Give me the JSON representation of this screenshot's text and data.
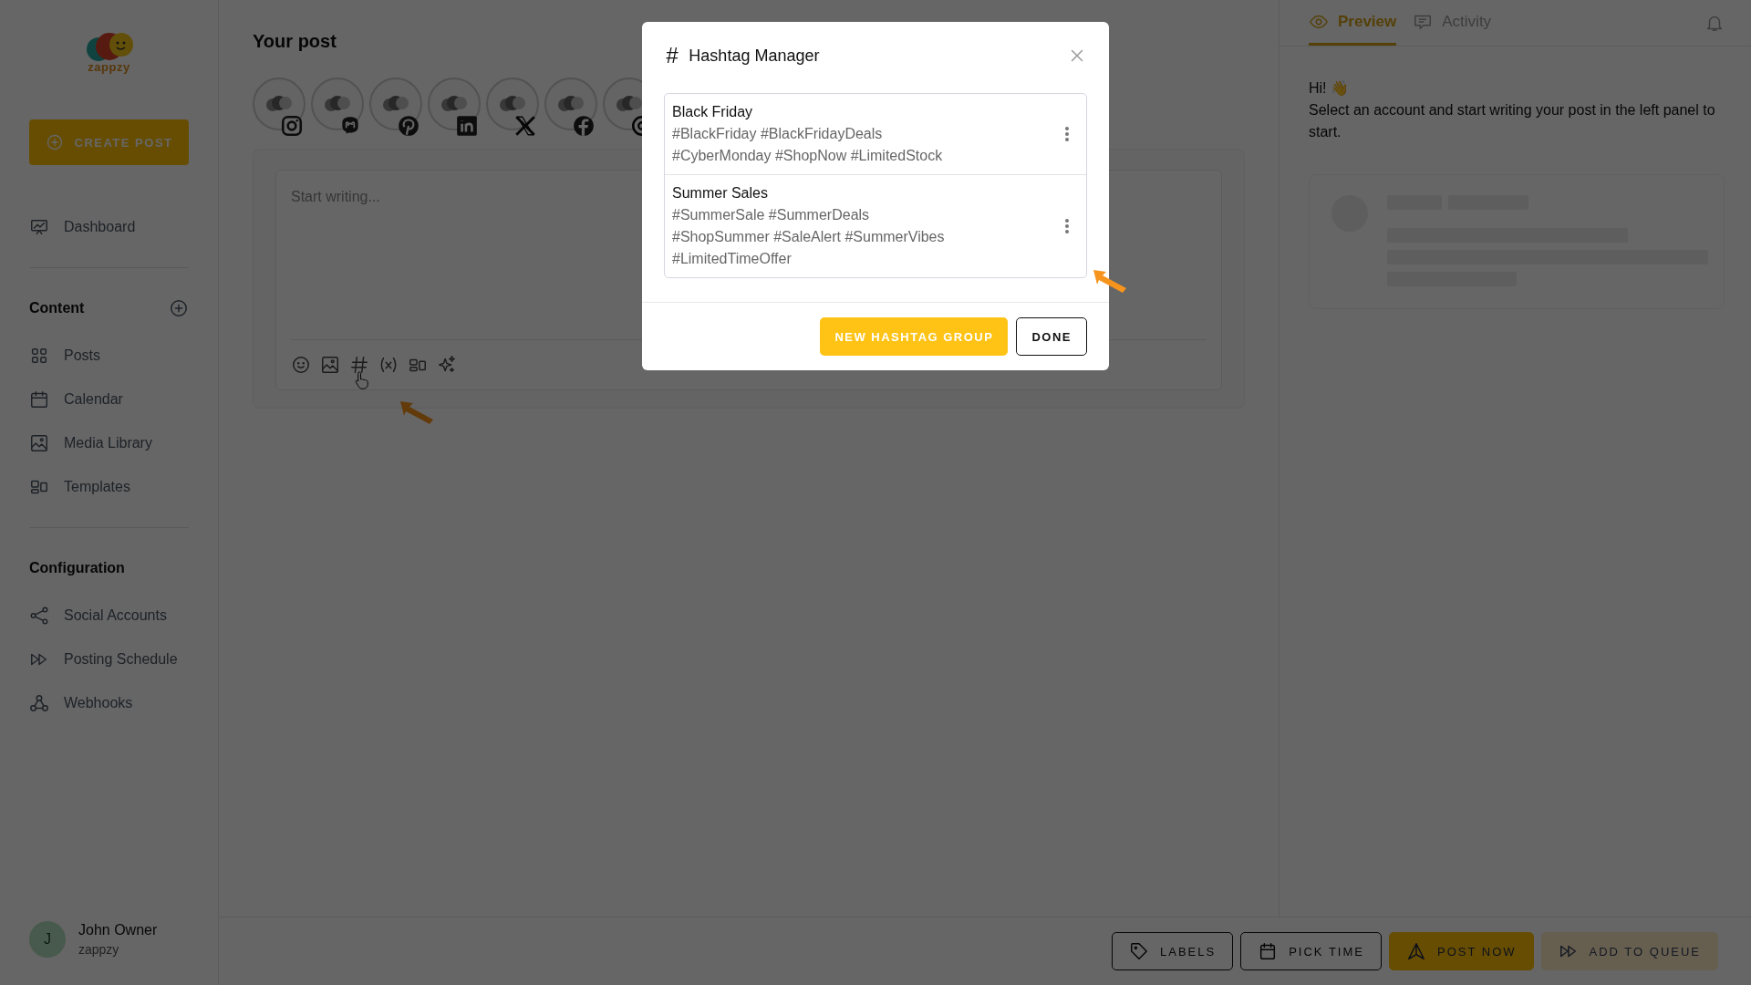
{
  "sidebar": {
    "logo_text": "zappzy",
    "create_button": "CREATE POST",
    "top_items": [
      {
        "label": "Dashboard",
        "selected": false
      }
    ],
    "sections": [
      {
        "title": "Content",
        "has_add": true,
        "items": [
          {
            "label": "Posts",
            "selected": false
          },
          {
            "label": "Calendar",
            "selected": false
          },
          {
            "label": "Media Library",
            "selected": false
          },
          {
            "label": "Templates",
            "selected": false
          }
        ]
      },
      {
        "title": "Configuration",
        "has_add": false,
        "items": [
          {
            "label": "Social Accounts",
            "selected": false
          },
          {
            "label": "Posting Schedule",
            "selected": false
          },
          {
            "label": "Webhooks",
            "selected": false
          }
        ]
      }
    ],
    "user": {
      "initial": "J",
      "name": "John Owner",
      "org": "zappzy"
    }
  },
  "post": {
    "title": "Your post",
    "accounts": [
      {
        "selected": false
      },
      {
        "selected": false
      },
      {
        "selected": false
      },
      {
        "selected": false
      },
      {
        "selected": false
      },
      {
        "selected": false
      },
      {
        "selected": false
      }
    ],
    "editor": {
      "placeholder": "Start writing..."
    }
  },
  "preview": {
    "tabs": [
      {
        "label": "Preview",
        "selected": true
      },
      {
        "label": "Activity",
        "selected": false
      }
    ],
    "greeting": "Hi! 👋",
    "message": "Select an account and start writing your post in the left panel to start."
  },
  "actions": [
    {
      "label": "LABELS",
      "kind": "outline"
    },
    {
      "label": "PICK TIME",
      "kind": "outline"
    },
    {
      "label": "POST NOW",
      "kind": "primary"
    },
    {
      "label": "ADD TO QUEUE",
      "kind": "muted"
    }
  ],
  "modal": {
    "icon": "#",
    "title": "Hashtag Manager",
    "groups": [
      {
        "name": "Black Friday",
        "lines": [
          "#BlackFriday #BlackFridayDeals",
          "#CyberMonday #ShopNow #LimitedStock"
        ]
      },
      {
        "name": "Summer Sales",
        "lines": [
          "#SummerSale #SummerDeals",
          "#ShopSummer #SaleAlert #SummerVibes",
          "#LimitedTimeOffer"
        ]
      }
    ],
    "buttons": [
      {
        "label": "NEW HASHTAG GROUP",
        "kind": "primary"
      },
      {
        "label": "DONE",
        "kind": "outline"
      }
    ]
  }
}
